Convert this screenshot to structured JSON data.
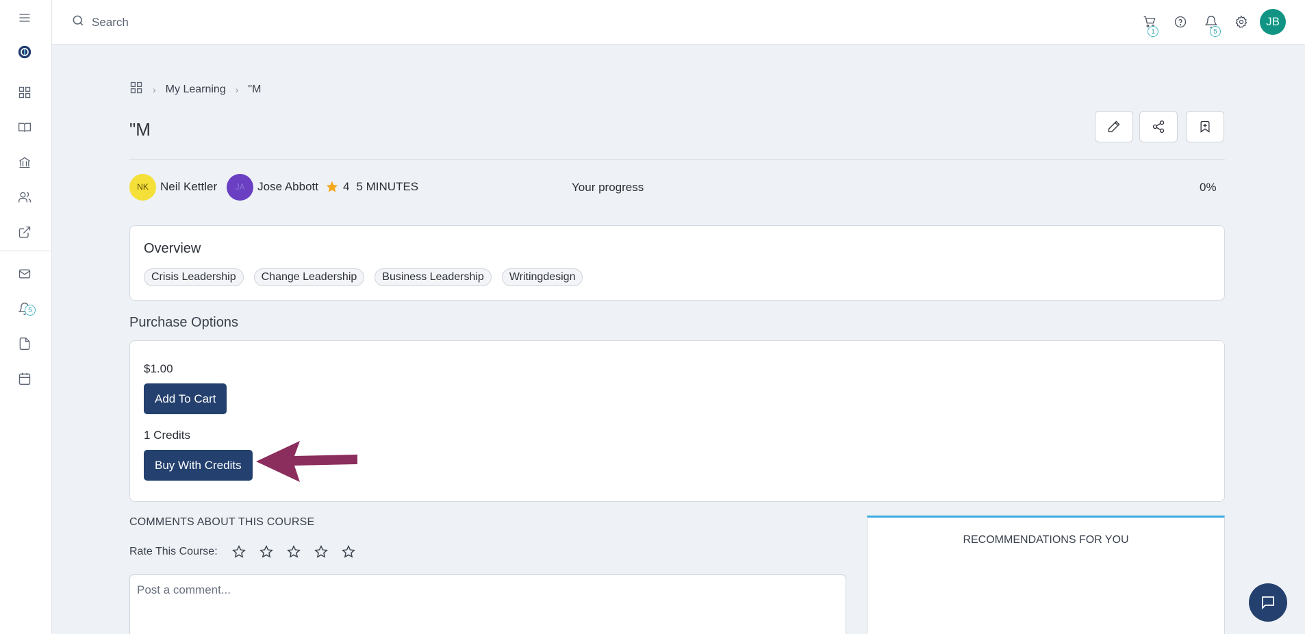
{
  "search": {
    "placeholder": "Search"
  },
  "topbar": {
    "cart_badge": "1",
    "notifications_badge": "5",
    "user_initials": "JB",
    "user_avatar_color": "#119484"
  },
  "sidebar": {
    "items": [
      {
        "name": "menu",
        "icon": "hamburger-icon"
      },
      {
        "name": "logo",
        "icon": "logo-icon"
      },
      {
        "name": "dashboard",
        "icon": "grid-icon"
      },
      {
        "name": "library",
        "icon": "book-open-icon"
      },
      {
        "name": "institution",
        "icon": "bank-icon"
      },
      {
        "name": "people",
        "icon": "users-icon"
      },
      {
        "name": "external",
        "icon": "external-link-icon"
      },
      {
        "name": "messages",
        "icon": "mail-icon"
      },
      {
        "name": "notifications",
        "icon": "bell-icon"
      },
      {
        "name": "documents",
        "icon": "file-icon"
      },
      {
        "name": "calendar",
        "icon": "calendar-icon"
      }
    ],
    "notifications_badge": "5"
  },
  "breadcrumb": {
    "items": [
      "My Learning",
      "\"M"
    ]
  },
  "page": {
    "title": "\"M"
  },
  "meta": {
    "authors": [
      {
        "initials": "NK",
        "name": "Neil Kettler",
        "color": "#f5e03a"
      },
      {
        "initials": "JA",
        "name": "Jose Abbott",
        "color": "#6a3fc2"
      }
    ],
    "rating": "4",
    "duration": "5 MINUTES",
    "progress_label": "Your progress",
    "progress_value": "0%"
  },
  "overview": {
    "title": "Overview",
    "tags": [
      "Crisis Leadership",
      "Change Leadership",
      "Business Leadership",
      "Writingdesign"
    ]
  },
  "purchase": {
    "title": "Purchase Options",
    "price": "$1.00",
    "add_to_cart_label": "Add To Cart",
    "credits": "1 Credits",
    "buy_credits_label": "Buy With Credits",
    "accent": "#23406e",
    "arrow_color": "#8b2d5d"
  },
  "comments": {
    "title": "COMMENTS ABOUT THIS COURSE",
    "rate_label": "Rate This Course:",
    "placeholder": "Post a comment..."
  },
  "recommendations": {
    "title": "RECOMMENDATIONS FOR YOU"
  }
}
